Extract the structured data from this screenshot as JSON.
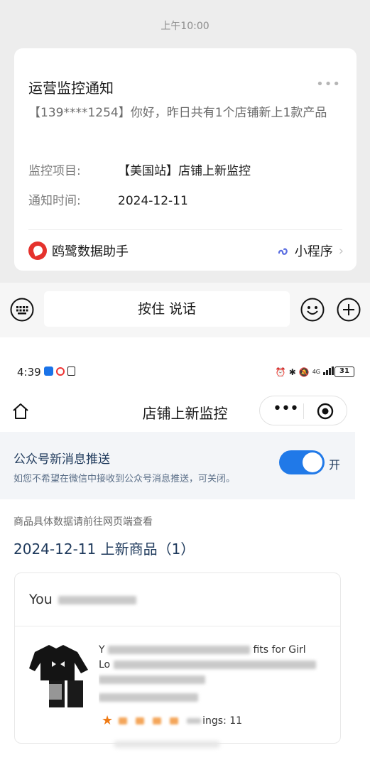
{
  "chat": {
    "time": "上午10:00",
    "card": {
      "title": "运营监控通知",
      "more": "•••",
      "description": "【139****1254】你好，昨日共有1个店铺新上1款产品",
      "fields": [
        {
          "label": "监控项目:",
          "value": "【美国站】店铺上新监控"
        },
        {
          "label": "通知时间:",
          "value": "2024-12-11"
        }
      ],
      "brand": "鸥鹭数据助手",
      "mini_program_label": "小程序",
      "chevron": "›"
    },
    "input_bar": {
      "hold_to_talk": "按住 说话"
    },
    "colors": {
      "background": "#ededed",
      "brand_red": "#e5322d",
      "mini_icon": "#5b6ee1"
    }
  },
  "phone": {
    "status": {
      "time": "4:39",
      "network": "4G",
      "battery": "31"
    },
    "nav": {
      "title": "店铺上新监控",
      "capsule_more": "•••"
    },
    "push": {
      "title": "公众号新消息推送",
      "description": "如您不希望在微信中接收到公众号消息推送，可关闭。",
      "toggle_on": true,
      "toggle_label": "开"
    },
    "hint": "商品具体数据请前往网页端查看",
    "section_title": "2024-12-11 上新商品（1）",
    "product": {
      "shop_prefix": "You",
      "title_line_1_prefix": "Y",
      "title_line_1_suffix": "fits for Girl",
      "title_line_2_prefix": "Lo",
      "rating_suffix": "ings: 11",
      "star": "★"
    },
    "colors": {
      "accent": "#2079e8",
      "title_navy": "#1f3a5c",
      "star_orange": "#ef7a14",
      "push_bg": "#f3f5f8"
    }
  }
}
